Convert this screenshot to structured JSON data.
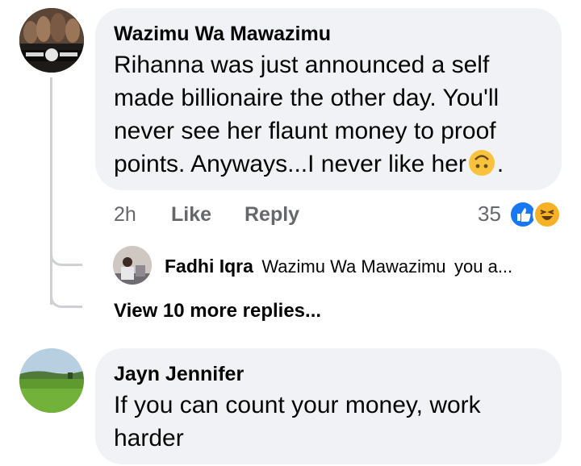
{
  "comments": [
    {
      "author": "Wazimu Wa Mawazimu",
      "text_line1": "Rihanna was just announced a self",
      "text_line2": "made billionaire the other day. You'll",
      "text_line3": "never see her flaunt money to proof",
      "text_line4": "points. Anyways...I never like her",
      "emoji": "upside-down-face-icon",
      "text_end": ".",
      "time": "2h",
      "like_label": "Like",
      "reply_label": "Reply",
      "reaction_count": "35",
      "reactions": [
        "like-icon",
        "haha-icon"
      ],
      "reply_preview": {
        "author": "Fadhi Iqra",
        "mention": "Wazimu Wa Mawazimu",
        "snippet": "you a..."
      },
      "view_more_replies": "View 10 more replies..."
    },
    {
      "author": "Jayn Jennifer",
      "text_line1": "If you can count your money, work",
      "text_line2": "harder"
    }
  ],
  "colors": {
    "bubble": "#f0f2f5",
    "meta_text": "#65676b",
    "like_blue": "#1877f2",
    "haha_yellow": "#f7b125"
  }
}
